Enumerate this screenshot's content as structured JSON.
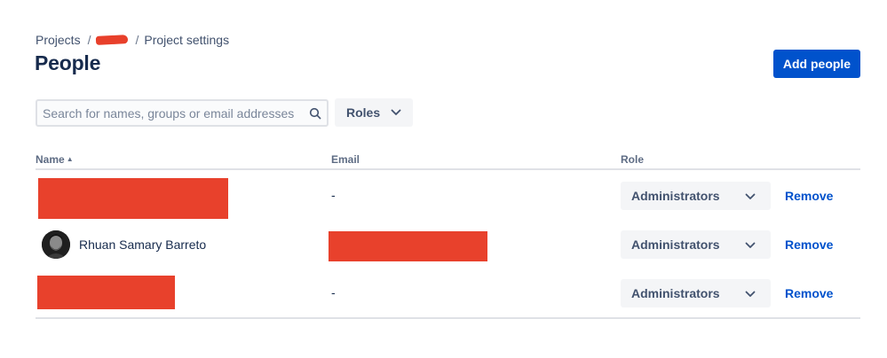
{
  "breadcrumb": {
    "items": [
      {
        "label": "Projects"
      },
      {
        "label": ""
      },
      {
        "label": "Project settings"
      }
    ],
    "separator": "/"
  },
  "page": {
    "title": "People"
  },
  "toolbar": {
    "add_label": "Add people",
    "search_placeholder": "Search for names, groups or email addresses",
    "search_value": "",
    "roles_label": "Roles"
  },
  "table": {
    "columns": {
      "name": "Name",
      "email": "Email",
      "role": "Role"
    },
    "sort_indicator": "▲",
    "rows": [
      {
        "name": "",
        "email": "-",
        "role": "Administrators",
        "action": "Remove"
      },
      {
        "name": "Rhuan Samary Barreto",
        "email": "",
        "role": "Administrators",
        "action": "Remove"
      },
      {
        "name": "",
        "email": "-",
        "role": "Administrators",
        "action": "Remove"
      }
    ]
  },
  "colors": {
    "accent": "#0052cc",
    "redaction": "#e8412c",
    "text": "#172b4d"
  },
  "icons": {
    "search": "search-icon",
    "chevron": "chevron-down-icon"
  }
}
